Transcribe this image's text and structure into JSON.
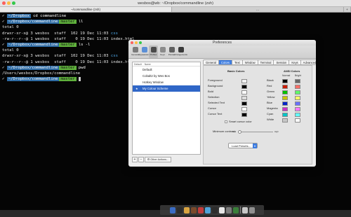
{
  "terminal": {
    "title": "wesbos@wb: ~/Dropbox/commandline (zsh)",
    "tabs": [
      "~/commandline (zsh)",
      "..."
    ],
    "lines": [
      {
        "kind": "prompt",
        "dir": "~/Dropbox",
        "git": "",
        "cmd": "cd commandline"
      },
      {
        "kind": "prompt",
        "dir": "~/Dropbox/commandline",
        "git": "master",
        "cmd": "ll"
      },
      {
        "kind": "text",
        "text": "total 0"
      },
      {
        "kind": "ls",
        "perm": "drwxr-xr-x@ 3 wesbos  staff  102 19 Dec 11:03 ",
        "name": "css",
        "isdir": true
      },
      {
        "kind": "ls",
        "perm": "-rw-r--r--@ 1 wesbos  staff    0 19 Dec 11:03 ",
        "name": "index.html",
        "isdir": false
      },
      {
        "kind": "prompt",
        "dir": "~/Dropbox/commandline",
        "git": "master",
        "cmd": "ls -l"
      },
      {
        "kind": "text",
        "text": "total 0"
      },
      {
        "kind": "ls",
        "perm": "drwxr-xr-x@ 3 wesbos  staff  102 19 Dec 11:03 ",
        "name": "css",
        "isdir": true
      },
      {
        "kind": "ls",
        "perm": "-rw-r--r--@ 1 wesbos  staff    0 19 Dec 11:03 ",
        "name": "index.html",
        "isdir": false
      },
      {
        "kind": "prompt",
        "dir": "~/Dropbox/commandline",
        "git": "master",
        "cmd": "pwd"
      },
      {
        "kind": "text",
        "text": "/Users/wesbos/Dropbox/commandline"
      },
      {
        "kind": "prompt",
        "dir": "~/Dropbox/commandline",
        "git": "master",
        "cmd": ""
      }
    ]
  },
  "preferences": {
    "title": "Preferences",
    "toolbar": [
      {
        "label": "General",
        "icon": "switch-icon",
        "color": "#7a7a7a"
      },
      {
        "label": "Appearance",
        "icon": "monitor-icon",
        "color": "#5b8fd6"
      },
      {
        "label": "Profiles",
        "icon": "profiles-icon",
        "color": "#4a4a4a"
      },
      {
        "label": "Keys",
        "icon": "keyboard-icon",
        "color": "#8b8b8b"
      },
      {
        "label": "Pointer",
        "icon": "pointer-icon",
        "color": "#5f5f5f"
      },
      {
        "label": "Arrangements",
        "icon": "arrangements-icon",
        "color": "#3a3a3a"
      }
    ],
    "search_placeholder": "Search",
    "list_header": [
      "Default",
      "Name"
    ],
    "profiles": [
      {
        "name": "Default",
        "default": false
      },
      {
        "name": "Cobalt2 by Wes Bos",
        "default": false
      },
      {
        "name": "Hotkey Window",
        "default": false
      },
      {
        "name": "My Colour Scheme",
        "default": true
      }
    ],
    "list_buttons": [
      "+",
      "−"
    ],
    "other_actions": "Other Actions...",
    "tabs": [
      "General",
      "Colors",
      "Text",
      "Window",
      "Terminal",
      "Session",
      "Keys",
      "Advanced"
    ],
    "selected_tab": "Colors",
    "basic_colors_header": "Basic Colors",
    "ansi_colors_header": "ANSI Colors",
    "ansi_subheaders": [
      "Normal",
      "Bright"
    ],
    "basic_colors": [
      {
        "label": "Foreground",
        "color": "#f2f2f2"
      },
      {
        "label": "Background",
        "color": "#000000"
      },
      {
        "label": "Bold",
        "color": "#ffffff"
      },
      {
        "label": "Selection",
        "color": "#dcdcdc"
      },
      {
        "label": "Selected Text",
        "color": "#000000"
      },
      {
        "label": "Cursor",
        "color": "#ffffff"
      },
      {
        "label": "Cursor Text",
        "color": "#000000"
      }
    ],
    "ansi_colors": [
      {
        "label": "Black",
        "normal": "#000000",
        "bright": "#686868"
      },
      {
        "label": "Red",
        "normal": "#c91b00",
        "bright": "#ff6e67"
      },
      {
        "label": "Green",
        "normal": "#00c200",
        "bright": "#5ffa68"
      },
      {
        "label": "Yellow",
        "normal": "#c7c400",
        "bright": "#fffc67"
      },
      {
        "label": "Blue",
        "normal": "#0225c7",
        "bright": "#6871ff"
      },
      {
        "label": "Magenta",
        "normal": "#c930c7",
        "bright": "#ff77ff"
      },
      {
        "label": "Cyan",
        "normal": "#00c5c7",
        "bright": "#60fdff"
      },
      {
        "label": "White",
        "normal": "#c7c7c7",
        "bright": "#ffffff"
      }
    ],
    "smart_cursor": "Smart cursor color",
    "min_contrast": "Minimum contrast:",
    "slider_low": "Low",
    "slider_high": "High",
    "load_presets": "Load Presets..."
  },
  "dock": {
    "icons": [
      "#3b6cc4",
      "#2c2c2c",
      "#d9a441",
      "#7a4a2b",
      "#c23b3b",
      "#4fa3d9",
      "#2d2d2d",
      "#e6e6e6",
      "#7b7b7b",
      "#3a7f3a",
      "#c7c7c7",
      "#909090"
    ]
  }
}
